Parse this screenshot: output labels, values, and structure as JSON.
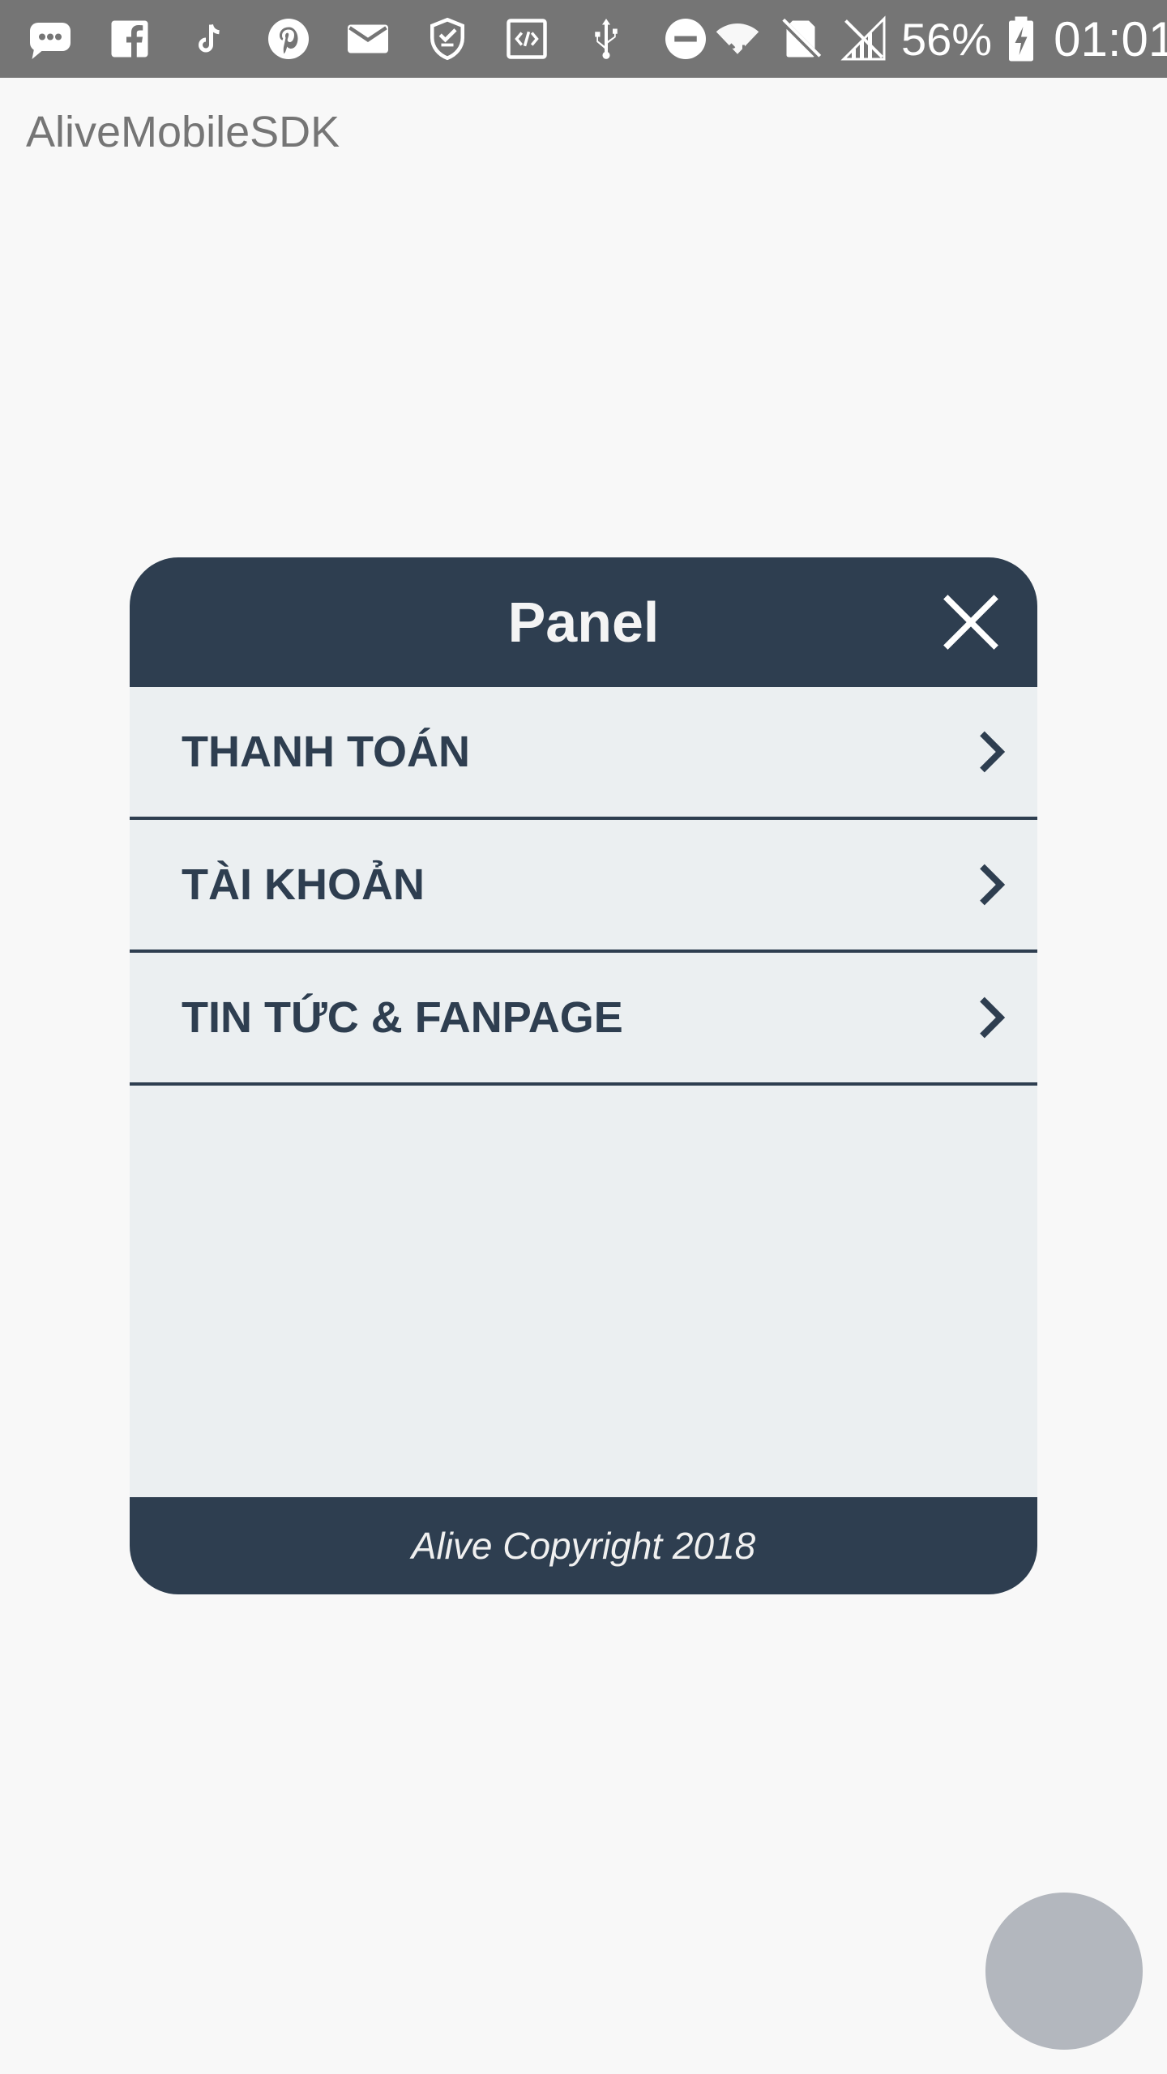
{
  "status_bar": {
    "icons": [
      "chat-bubble-icon",
      "facebook-icon",
      "tiktok-icon",
      "pinterest-icon",
      "mail-icon",
      "shield-icon",
      "code-icon",
      "usb-icon",
      "do-not-disturb-icon",
      "wifi-icon",
      "no-sim-icon",
      "signal-icon",
      "battery-charging-icon"
    ],
    "battery_percent": "56%",
    "time": "01:01"
  },
  "app": {
    "title": "AliveMobileSDK"
  },
  "panel": {
    "title": "Panel",
    "close_icon": "close-icon",
    "items": [
      {
        "label": "THANH TOÁN",
        "icon": "chevron-right-icon"
      },
      {
        "label": "TÀI KHOẢN",
        "icon": "chevron-right-icon"
      },
      {
        "label": "TIN TỨC & FANPAGE",
        "icon": "chevron-right-icon"
      }
    ],
    "footer": "Alive Copyright 2018"
  },
  "colors": {
    "status_bar": "#757575",
    "background": "#f8f8f8",
    "panel_dark": "#2e3e50",
    "panel_body": "#ebeff1",
    "fab": "#b3b7be"
  }
}
